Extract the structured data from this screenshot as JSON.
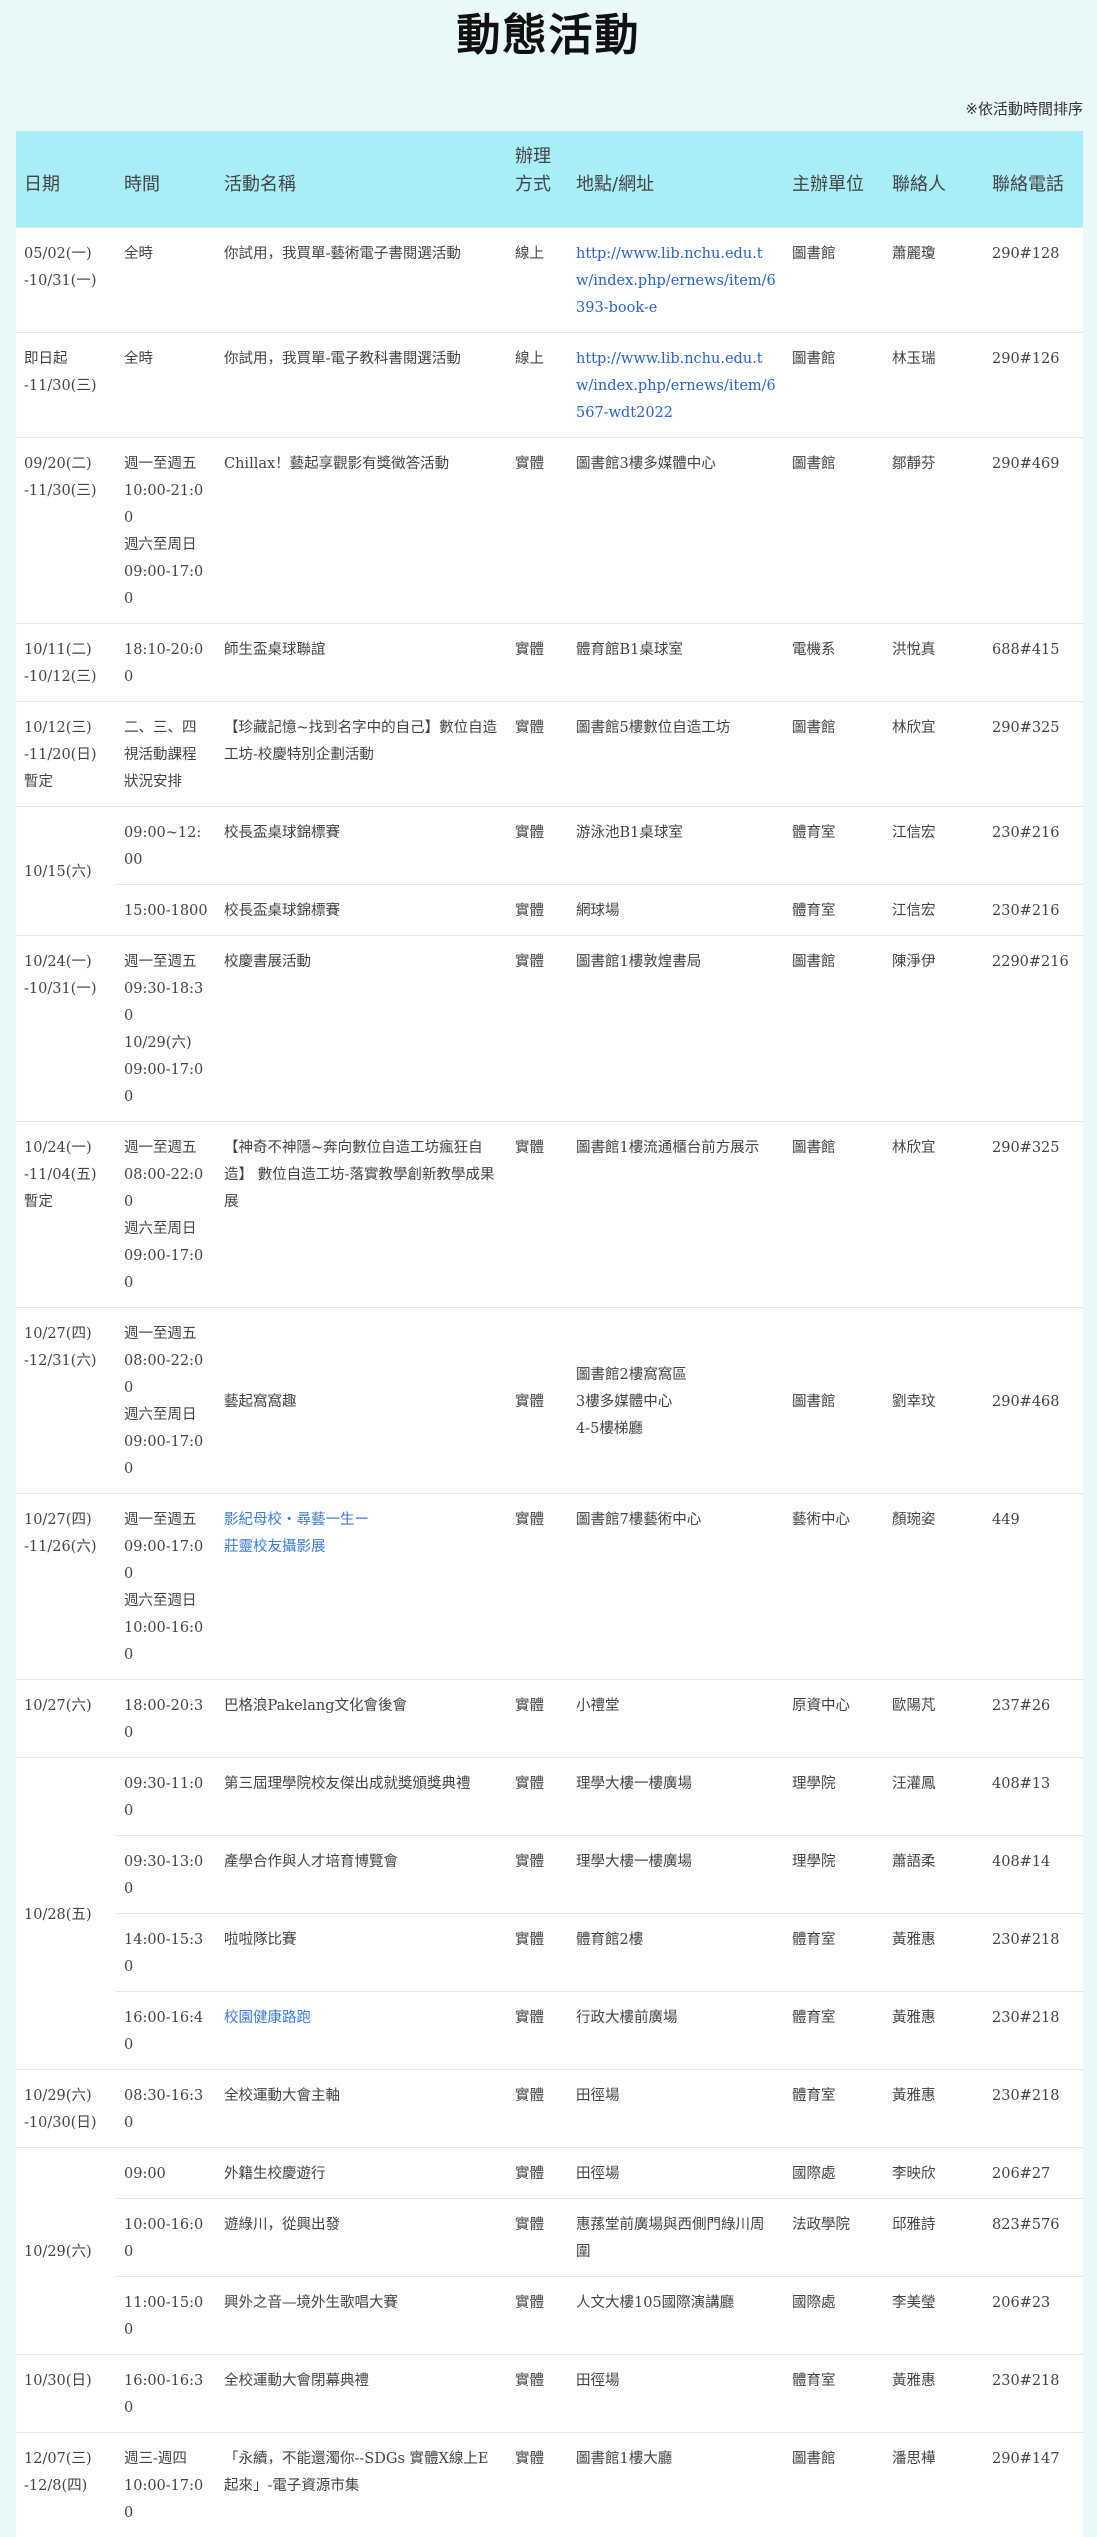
{
  "page": {
    "title": "動態活動",
    "note": "※依活動時間排序"
  },
  "table": {
    "headers": {
      "date": "日期",
      "time": "時間",
      "name": "活動名稱",
      "mode": "辦理方式",
      "place": "地點/網址",
      "org": "主辦單位",
      "contact": "聯絡人",
      "phone": "聯絡電話"
    },
    "rows": [
      {
        "date": "05/02(一)\n-10/31(一)",
        "time": "全時",
        "name": "你試用，我買單-藝術電子書閱選活動",
        "mode": "線上",
        "place": "http://www.lib.nchu.edu.tw/index.php/ernews/item/6393-book-e",
        "org": "圖書館",
        "contact": "蕭麗瓊",
        "phone": "290#128"
      },
      {
        "date": "即日起\n-11/30(三)",
        "time": "全時",
        "name": "你試用，我買單-電子教科書閱選活動",
        "mode": "線上",
        "place": "http://www.lib.nchu.edu.tw/index.php/ernews/item/6567-wdt2022",
        "org": "圖書館",
        "contact": "林玉瑞",
        "phone": "290#126"
      },
      {
        "date": "09/20(二)\n-11/30(三)",
        "time": "週一至週五\n10:00-21:00\n週六至周日\n09:00-17:00",
        "name": "Chillax！藝起享觀影有獎徵答活動",
        "mode": "實體",
        "place": "圖書館3樓多媒體中心",
        "org": "圖書館",
        "contact": "鄒靜芬",
        "phone": "290#469"
      },
      {
        "date": "10/11(二)\n-10/12(三)",
        "time": "18:10-20:00",
        "name": "師生盃桌球聯誼",
        "mode": "實體",
        "place": "體育館B1桌球室",
        "org": "電機系",
        "contact": "洪悅真",
        "phone": "688#415"
      },
      {
        "date": "10/12(三)\n-11/20(日)\n暫定",
        "time": "二、三、四\n視活動課程\n狀況安排",
        "name": "【珍藏記憶~找到名字中的自己】數位自造工坊-校慶特別企劃活動",
        "mode": "實體",
        "place": "圖書館5樓數位自造工坊",
        "org": "圖書館",
        "contact": "林欣宜",
        "phone": "290#325"
      },
      {
        "date": "10/15(六)",
        "time": "09:00~12:00",
        "name": "校長盃桌球錦標賽",
        "mode": "實體",
        "place": "游泳池B1桌球室",
        "org": "體育室",
        "contact": "江信宏",
        "phone": "230#216"
      },
      {
        "time": "15:00-1800",
        "name": "校長盃桌球錦標賽",
        "mode": "實體",
        "place": "網球場",
        "org": "體育室",
        "contact": "江信宏",
        "phone": "230#216"
      },
      {
        "date": "10/24(一)\n-10/31(一)",
        "time": "週一至週五\n09:30-18:30\n10/29(六)\n09:00-17:00",
        "name": "校慶書展活動",
        "mode": "實體",
        "place": "圖書館1樓敦煌書局",
        "org": "圖書館",
        "contact": "陳淨伊",
        "phone": "2290#216"
      },
      {
        "date": "10/24(一)\n-11/04(五)\n暫定",
        "time": "週一至週五\n08:00-22:00\n週六至周日\n09:00-17:00",
        "name": "【神奇不神隱~奔向數位自造工坊瘋狂自造】 數位自造工坊-落實教學創新教學成果展",
        "mode": "實體",
        "place": "圖書館1樓流通櫃台前方展示",
        "org": "圖書館",
        "contact": "林欣宜",
        "phone": "290#325"
      },
      {
        "date": "10/27(四)\n-12/31(六)",
        "time": "週一至週五\n08:00-22:00\n週六至周日\n09:00-17:00",
        "name": "藝起窩窩趣",
        "mode": "實體",
        "place": "圖書館2樓窩窩區\n3樓多媒體中心\n4-5樓梯廳",
        "org": "圖書館",
        "contact": "劉幸玟",
        "phone": "290#468",
        "middle": true
      },
      {
        "date": "10/27(四)\n-11/26(六)",
        "time": "週一至週五\n09:00-17:00\n週六至週日\n10:00-16:00",
        "name": "影紀母校‧尋藝一生ー\n莊靈校友攝影展",
        "mode": "實體",
        "place": "圖書館7樓藝術中心",
        "org": "藝術中心",
        "contact": "顏琬姿",
        "phone": "449",
        "blueName": true
      },
      {
        "date": "10/27(六)",
        "time": "18:00-20:30",
        "name": "巴格浪Pakelang文化會後會",
        "mode": "實體",
        "place": "小禮堂",
        "org": "原資中心",
        "contact": "歐陽芃",
        "phone": "237#26"
      },
      {
        "date": "10/28(五)",
        "time": "09:30-11:00",
        "name": "第三屆理學院校友傑出成就獎頒獎典禮",
        "mode": "實體",
        "place": "理學大樓一樓廣場",
        "org": "理學院",
        "contact": "汪灌鳳",
        "phone": "408#13"
      },
      {
        "time": "09:30-13:00",
        "name": "產學合作與人才培育博覽會",
        "mode": "實體",
        "place": "理學大樓一樓廣場",
        "org": "理學院",
        "contact": "蕭語柔",
        "phone": "408#14"
      },
      {
        "time": "14:00-15:30",
        "name": "啦啦隊比賽",
        "mode": "實體",
        "place": "體育館2樓",
        "org": "體育室",
        "contact": "黃雅惠",
        "phone": "230#218"
      },
      {
        "time": "16:00-16:40",
        "name": "校園健康路跑",
        "mode": "實體",
        "place": "行政大樓前廣場",
        "org": "體育室",
        "contact": "黃雅惠",
        "phone": "230#218",
        "blueName": true
      },
      {
        "date": "10/29(六)\n-10/30(日)",
        "time": "08:30-16:30",
        "name": "全校運動大會主軸",
        "mode": "實體",
        "place": "田徑場",
        "org": "體育室",
        "contact": "黃雅惠",
        "phone": "230#218"
      },
      {
        "date": "10/29(六)",
        "time": "09:00",
        "name": "外籍生校慶遊行",
        "mode": "實體",
        "place": "田徑場",
        "org": "國際處",
        "contact": "李映欣",
        "phone": "206#27"
      },
      {
        "time": "10:00-16:00",
        "name": "遊綠川，從興出發",
        "mode": "實體",
        "place": "惠蓀堂前廣場與西側門綠川周圍",
        "org": "法政學院",
        "contact": "邱雅詩",
        "phone": "823#576"
      },
      {
        "time": "11:00-15:00",
        "name": "興外之音—境外生歌唱大賽",
        "mode": "實體",
        "place": "人文大樓105國際演講廳",
        "org": "國際處",
        "contact": "李美瑩",
        "phone": "206#23"
      },
      {
        "date": "10/30(日)",
        "time": "16:00-16:30",
        "name": "全校運動大會閉幕典禮",
        "mode": "實體",
        "place": "田徑場",
        "org": "體育室",
        "contact": "黃雅惠",
        "phone": "230#218"
      },
      {
        "date": "12/07(三)\n-12/8(四)",
        "time": "週三-週四\n10:00-17:00",
        "name": "「永續，不能還濁你--SDGs 實體X線上E起來」-電子資源市集",
        "mode": "實體",
        "place": "圖書館1樓大廳",
        "org": "圖書館",
        "contact": "潘思樺",
        "phone": "290#147"
      }
    ]
  }
}
